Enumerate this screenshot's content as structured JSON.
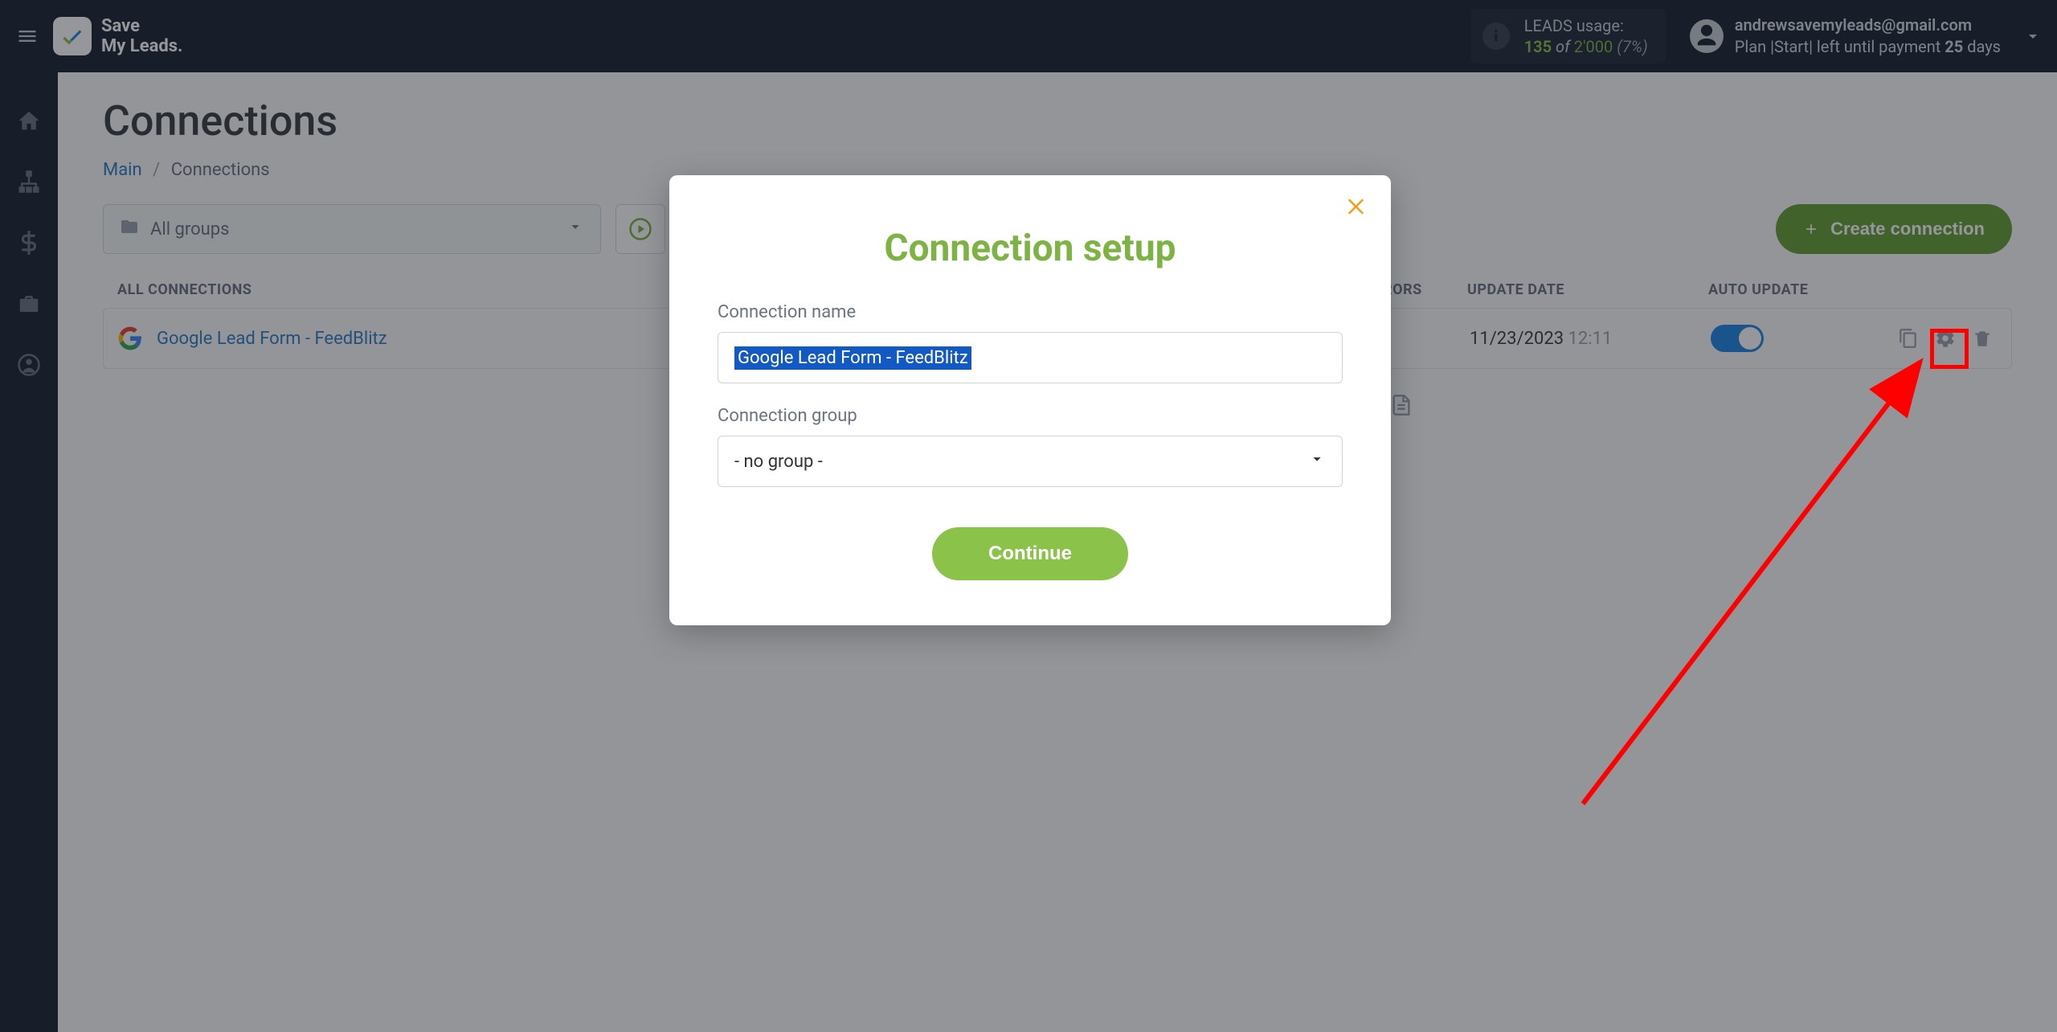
{
  "brand": {
    "line1": "Save",
    "line2": "My Leads."
  },
  "usage": {
    "label": "LEADS usage:",
    "used": "135",
    "of_word": "of",
    "total": "2'000",
    "pct": "(7%)"
  },
  "user": {
    "email": "andrewsavemyleads@gmail.com",
    "plan_prefix": "Plan |Start| left until payment ",
    "days_num": "25",
    "days_word": " days"
  },
  "page": {
    "title": "Connections",
    "breadcrumb_main": "Main",
    "breadcrumb_current": "Connections"
  },
  "toolbar": {
    "group_filter": "All groups",
    "create_btn": "Create connection"
  },
  "table": {
    "head_all": "ALL CONNECTIONS",
    "head_log": "LOG / ERRORS",
    "head_update": "UPDATE DATE",
    "head_auto": "AUTO UPDATE",
    "rows": [
      {
        "name": "Google Lead Form - FeedBlitz",
        "date": "11/23/2023",
        "time": "12:11"
      }
    ]
  },
  "modal": {
    "title": "Connection setup",
    "name_label": "Connection name",
    "name_value": "Google Lead Form - FeedBlitz",
    "group_label": "Connection group",
    "group_value": "- no group -",
    "continue": "Continue"
  }
}
